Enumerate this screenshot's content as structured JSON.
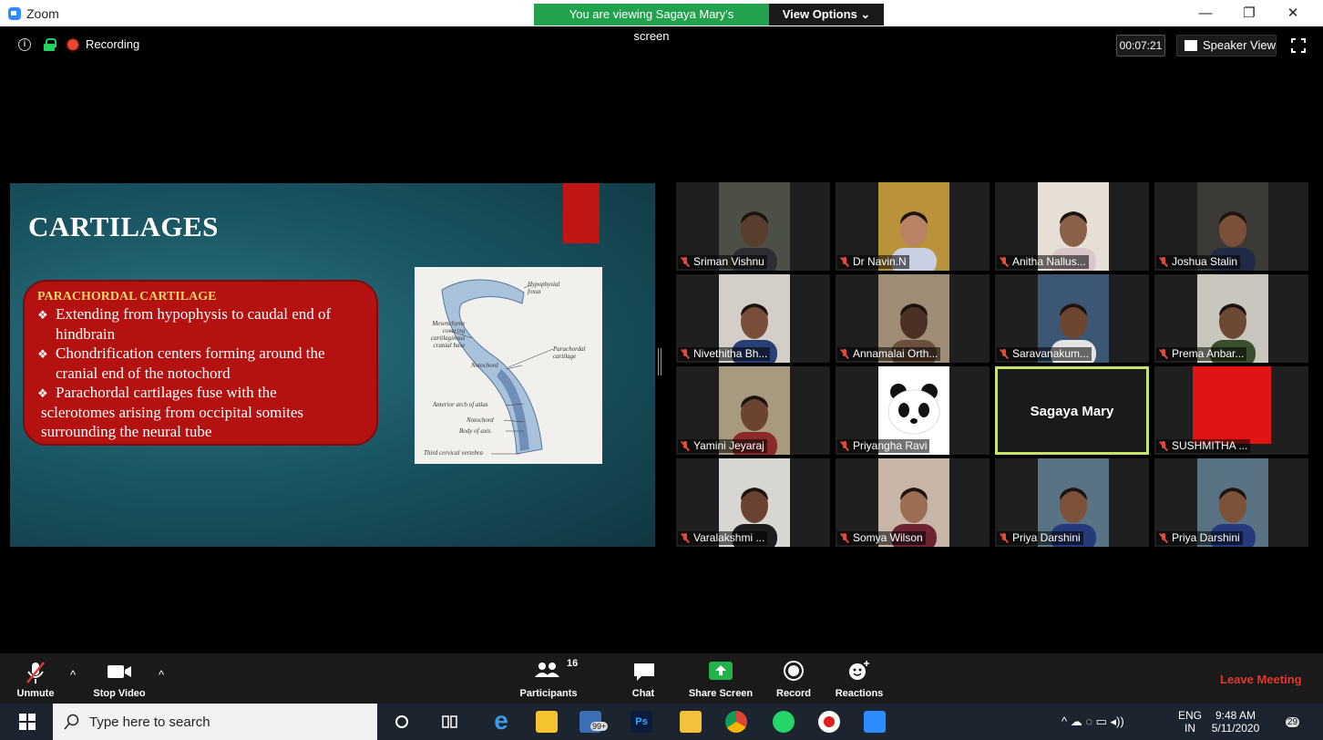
{
  "window": {
    "title": "Zoom"
  },
  "banner": {
    "viewing_text": "You are viewing Sagaya Mary's screen",
    "view_options": "View Options ⌄"
  },
  "window_controls": {
    "minimize": "—",
    "restore": "❐",
    "close": "✕"
  },
  "topbar": {
    "recording": "Recording",
    "timer": "00:07:21",
    "speaker_view": "Speaker View"
  },
  "slide": {
    "title": "CARTILAGES",
    "heading": "PARACHORDAL CARTILAGE",
    "points": [
      "Extending from hypophysis to caudal end of",
      "hindbrain",
      "Chondrification centers forming around the",
      "cranial end of the notochord",
      "Parachordal cartilages fuse with the",
      "sclerotomes arising from occipital somites",
      "surrounding the neural tube"
    ],
    "bullet_a": "❖",
    "bullet_b": "❖",
    "bullet_c": "❖",
    "figure_labels": {
      "hypophysial": "Hypophysial",
      "fossa": "fossa",
      "mesenchyme": "Mesenchyme",
      "covering": "covering",
      "cartilaginous": "cartilaginous",
      "cranial_base": "cranial base",
      "parachordal": "Parachordal",
      "cartilage": "cartilage",
      "notochord1": "Notochord",
      "anterior_arch": "Anterior arch of atlas",
      "notochord2": "Notochord",
      "body_axis": "Body of axis",
      "third_cervical": "Third cervical vertebra"
    }
  },
  "participants": [
    {
      "name": "Sriman Vishnu",
      "bg": "#4b4f46",
      "skin": "#5b3d2d",
      "shirt": "#2d2d33"
    },
    {
      "name": "Dr Navin.N",
      "bg": "#b9923a",
      "skin": "#b88362",
      "shirt": "#c8cfe0"
    },
    {
      "name": "Anitha Nallus...",
      "bg": "#e6dfd6",
      "skin": "#8a6048",
      "shirt": "#d9c6c9"
    },
    {
      "name": "Joshua Stalin",
      "bg": "#3b3a36",
      "skin": "#7a5138",
      "shirt": "#1f2a44"
    },
    {
      "name": "Nivethitha Bh...",
      "bg": "#d3cec8",
      "skin": "#7a4f39",
      "shirt": "#2a3f76"
    },
    {
      "name": "Annamalai Orth...",
      "bg": "#9f8d76",
      "skin": "#4a3025",
      "shirt": "#6b4e3b"
    },
    {
      "name": "Saravanakum...",
      "bg": "#3c5675",
      "skin": "#6e4630",
      "shirt": "#e3e3e3"
    },
    {
      "name": "Prema Anbar...",
      "bg": "#c9c7bd",
      "skin": "#6d4832",
      "shirt": "#3a4e2e"
    },
    {
      "name": "Yamini Jeyaraj",
      "bg": "#a89a7e",
      "skin": "#6a4431",
      "shirt": "#8b2a2a"
    },
    {
      "name": "Priyangha Ravi",
      "bg": "#ffffff",
      "skin": "#ffffff",
      "shirt": "#ffffff"
    },
    {
      "name": "Sagaya Mary",
      "bg": "#1a1a1a",
      "skin": "#1a1a1a",
      "shirt": "#1a1a1a"
    },
    {
      "name": "SUSHMITHA ...",
      "bg": "#e11414",
      "skin": "#e11414",
      "shirt": "#e11414"
    },
    {
      "name": "Varalakshmi ...",
      "bg": "#d8d6d2",
      "skin": "#6b4230",
      "shirt": "#1c1c1c"
    },
    {
      "name": "Somya Wilson",
      "bg": "#c7b6a8",
      "skin": "#9b6d52",
      "shirt": "#6c2433"
    },
    {
      "name": "Priya Darshini",
      "bg": "#5a7384",
      "skin": "#7d5239",
      "shirt": "#243a7a"
    },
    {
      "name": "Priya Darshini",
      "bg": "#5a7384",
      "skin": "#7d5239",
      "shirt": "#243a7a"
    }
  ],
  "toolbar": {
    "unmute": "Unmute",
    "stop_video": "Stop Video",
    "participants": "Participants",
    "participant_count": "16",
    "chat": "Chat",
    "share_screen": "Share Screen",
    "record": "Record",
    "reactions": "Reactions",
    "leave": "Leave Meeting",
    "caret": "^"
  },
  "taskbar": {
    "search_placeholder": "Type here to search",
    "mail_badge": "99+",
    "lang1": "ENG",
    "lang2": "IN",
    "time": "9:48 AM",
    "date": "5/11/2020",
    "notif_count": "29",
    "ps_label": "Ps",
    "edge_label": "e"
  },
  "colors": {
    "accent_green": "#23a24d",
    "leave_red": "#e0392c",
    "active_border": "#c9e36a"
  }
}
